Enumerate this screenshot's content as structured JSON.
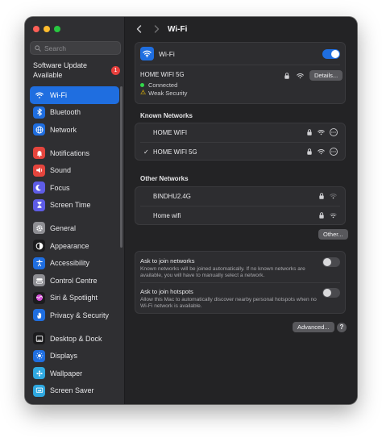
{
  "sidebar": {
    "search_placeholder": "Search",
    "software_update": {
      "label": "Software Update Available",
      "badge": "1"
    },
    "items": [
      {
        "label": "Wi-Fi",
        "icon": "wifi-icon",
        "color": "#1f6ee0"
      },
      {
        "label": "Bluetooth",
        "icon": "bluetooth-icon",
        "color": "#1f6ee0"
      },
      {
        "label": "Network",
        "icon": "globe-icon",
        "color": "#1f6ee0"
      },
      {
        "label": "Notifications",
        "icon": "bell-icon",
        "color": "#e5453d"
      },
      {
        "label": "Sound",
        "icon": "speaker-icon",
        "color": "#e5453d"
      },
      {
        "label": "Focus",
        "icon": "moon-icon",
        "color": "#5e5ce6"
      },
      {
        "label": "Screen Time",
        "icon": "hourglass-icon",
        "color": "#5e5ce6"
      },
      {
        "label": "General",
        "icon": "gear-icon",
        "color": "#8e8e93"
      },
      {
        "label": "Appearance",
        "icon": "appearance-icon",
        "color": "#1c1c1e"
      },
      {
        "label": "Accessibility",
        "icon": "accessibility-icon",
        "color": "#1f6ee0"
      },
      {
        "label": "Control Centre",
        "icon": "control-centre-icon",
        "color": "#8e8e93"
      },
      {
        "label": "Siri & Spotlight",
        "icon": "siri-icon",
        "color": "#1c1c1e"
      },
      {
        "label": "Privacy & Security",
        "icon": "hand-icon",
        "color": "#1f6ee0"
      },
      {
        "label": "Desktop & Dock",
        "icon": "dock-icon",
        "color": "#1c1c1e"
      },
      {
        "label": "Displays",
        "icon": "sun-icon",
        "color": "#1f6ee0"
      },
      {
        "label": "Wallpaper",
        "icon": "wallpaper-icon",
        "color": "#2fa8e0"
      },
      {
        "label": "Screen Saver",
        "icon": "screen-saver-icon",
        "color": "#2fa8e0"
      }
    ]
  },
  "main": {
    "title": "Wi-Fi",
    "wifi_toggle": {
      "label": "Wi-Fi",
      "on": true
    },
    "current": {
      "ssid": "HOME WIFI 5G",
      "status": "Connected",
      "warning": "Weak Security",
      "details_label": "Details..."
    },
    "known_title": "Known Networks",
    "known": [
      {
        "name": "HOME WIFI",
        "checked": false
      },
      {
        "name": "HOME WIFI 5G",
        "checked": true
      }
    ],
    "other_title": "Other Networks",
    "others": [
      {
        "name": "BINDHU2.4G"
      },
      {
        "name": "Home wifi"
      }
    ],
    "other_button": "Other...",
    "ask_join": {
      "title": "Ask to join networks",
      "desc": "Known networks will be joined automatically. If no known networks are available, you will have to manually select a network."
    },
    "ask_hotspots": {
      "title": "Ask to join hotspots",
      "desc": "Allow this Mac to automatically discover nearby personal hotspots when no Wi-Fi network is available."
    },
    "advanced_button": "Advanced...",
    "help_label": "?"
  }
}
